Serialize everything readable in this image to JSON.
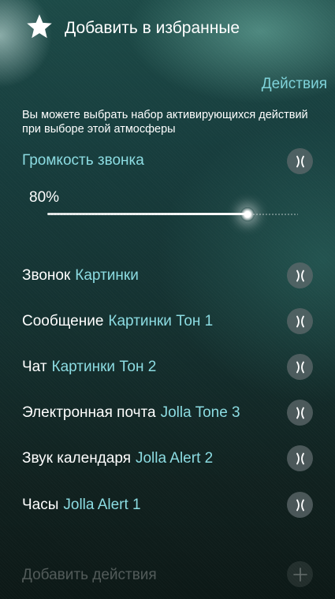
{
  "favorite": {
    "label": "Добавить в избранные",
    "icon": "star-icon"
  },
  "section_header": "Действия",
  "description": "Вы можете выбрать набор активирующихся действий при выборе этой атмосферы",
  "volume": {
    "label": "Громкость звонка",
    "value_text": "80%",
    "level": 0.8
  },
  "actions": [
    {
      "name": "Звонок",
      "value": "Картинки"
    },
    {
      "name": "Сообщение",
      "value": "Картинки Тон 1"
    },
    {
      "name": "Чат",
      "value": "Картинки Тон 2"
    },
    {
      "name": "Электронная почта",
      "value": "Jolla Tone 3"
    },
    {
      "name": "Звук календаря",
      "value": "Jolla Alert 2"
    },
    {
      "name": "Часы",
      "value": "Jolla Alert 1"
    }
  ],
  "add_action_label": "Добавить действия",
  "colors": {
    "accent": "#8cdce2",
    "disabled_text": "#ffffff47",
    "remove_button_bg": "#5f696c"
  }
}
